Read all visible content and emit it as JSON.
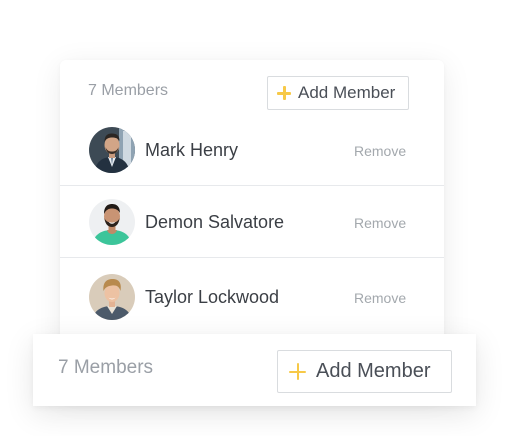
{
  "panel": {
    "members_count": "7 Members",
    "add_member_label": "Add Member",
    "members": [
      {
        "name": "Mark Henry",
        "remove_label": "Remove",
        "avatar": "avatar-man-suit"
      },
      {
        "name": "Demon Salvatore",
        "remove_label": "Remove",
        "avatar": "avatar-man-green-shirt"
      },
      {
        "name": "Taylor Lockwood",
        "remove_label": "Remove",
        "avatar": "avatar-man-blond"
      }
    ]
  },
  "footer": {
    "members_count": "7 Members",
    "add_member_label": "Add Member"
  },
  "colors": {
    "accent_plus": "#f7c948",
    "muted_text": "#9a9fa6",
    "primary_text": "#3b3f45",
    "divider": "#e7e9ec"
  }
}
